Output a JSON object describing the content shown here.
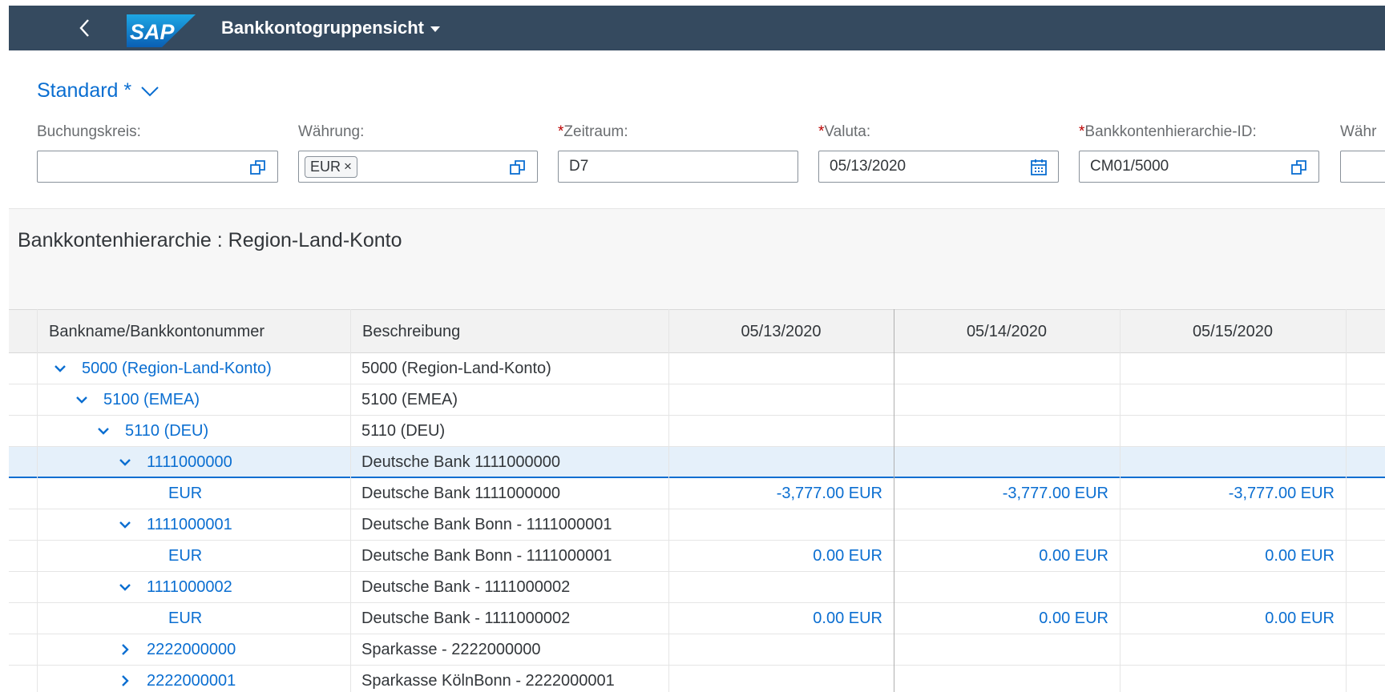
{
  "shell": {
    "logo_text": "SAP",
    "title": "Bankkontogruppensicht"
  },
  "filter": {
    "variant": "Standard *",
    "fields": [
      {
        "label": "Buchungskreis:",
        "required": false,
        "value": "",
        "token": ""
      },
      {
        "label": "Währung:",
        "required": false,
        "value": "",
        "token": "EUR"
      },
      {
        "label": "Zeitraum:",
        "required": true,
        "value": "D7",
        "token": ""
      },
      {
        "label": "Valuta:",
        "required": true,
        "value": "05/13/2020",
        "token": ""
      },
      {
        "label": "Bankkontenhierarchie-ID:",
        "required": true,
        "value": "CM01/5000",
        "token": ""
      },
      {
        "label": "Währ",
        "required": false,
        "value": "",
        "token": ""
      }
    ],
    "token_remove": "×",
    "required_mark": "*"
  },
  "section": {
    "title": "Bankkontenhierarchie : Region-Land-Konto"
  },
  "table": {
    "columns": [
      "Bankname/Bankkontonummer",
      "Beschreibung",
      "05/13/2020",
      "05/14/2020",
      "05/15/2020"
    ],
    "rows": [
      {
        "level": 0,
        "expander": "down",
        "name": "5000 (Region-Land-Konto)",
        "desc": "5000 (Region-Land-Konto)",
        "v1": "",
        "v2": "",
        "v3": ""
      },
      {
        "level": 1,
        "expander": "down",
        "name": "5100 (EMEA)",
        "desc": "5100 (EMEA)",
        "v1": "",
        "v2": "",
        "v3": ""
      },
      {
        "level": 2,
        "expander": "down",
        "name": "5110 (DEU)",
        "desc": "5110 (DEU)",
        "v1": "",
        "v2": "",
        "v3": ""
      },
      {
        "level": 3,
        "expander": "down",
        "name": "1111000000",
        "desc": "Deutsche Bank 1111000000",
        "v1": "",
        "v2": "",
        "v3": "",
        "selected": true
      },
      {
        "level": 4,
        "expander": "none",
        "name": "EUR",
        "desc": "Deutsche Bank 1111000000",
        "v1": "-3,777.00 EUR",
        "v2": "-3,777.00 EUR",
        "v3": "-3,777.00 EUR"
      },
      {
        "level": 3,
        "expander": "down",
        "name": "1111000001",
        "desc": "Deutsche Bank Bonn - 1111000001",
        "v1": "",
        "v2": "",
        "v3": ""
      },
      {
        "level": 4,
        "expander": "none",
        "name": "EUR",
        "desc": "Deutsche Bank Bonn - 1111000001",
        "v1": "0.00 EUR",
        "v2": "0.00 EUR",
        "v3": "0.00 EUR"
      },
      {
        "level": 3,
        "expander": "down",
        "name": "1111000002",
        "desc": "Deutsche Bank - 1111000002",
        "v1": "",
        "v2": "",
        "v3": ""
      },
      {
        "level": 4,
        "expander": "none",
        "name": "EUR",
        "desc": "Deutsche Bank - 1111000002",
        "v1": "0.00 EUR",
        "v2": "0.00 EUR",
        "v3": "0.00 EUR"
      },
      {
        "level": 3,
        "expander": "right",
        "name": "2222000000",
        "desc": "Sparkasse - 2222000000",
        "v1": "",
        "v2": "",
        "v3": ""
      },
      {
        "level": 3,
        "expander": "right",
        "name": "2222000001",
        "desc": "Sparkasse KölnBonn - 2222000001",
        "v1": "",
        "v2": "",
        "v3": ""
      }
    ]
  },
  "icons": {
    "back": "back-icon",
    "variant": "chevron-down-icon",
    "value_help": "value-help-icon",
    "calendar": "calendar-icon",
    "expand": "expand-icon",
    "collapse": "collapse-icon"
  },
  "colors": {
    "shell": "#354a5f",
    "link": "#0a6ed1",
    "required": "#bb0000",
    "selection": "#e5f0fa"
  }
}
